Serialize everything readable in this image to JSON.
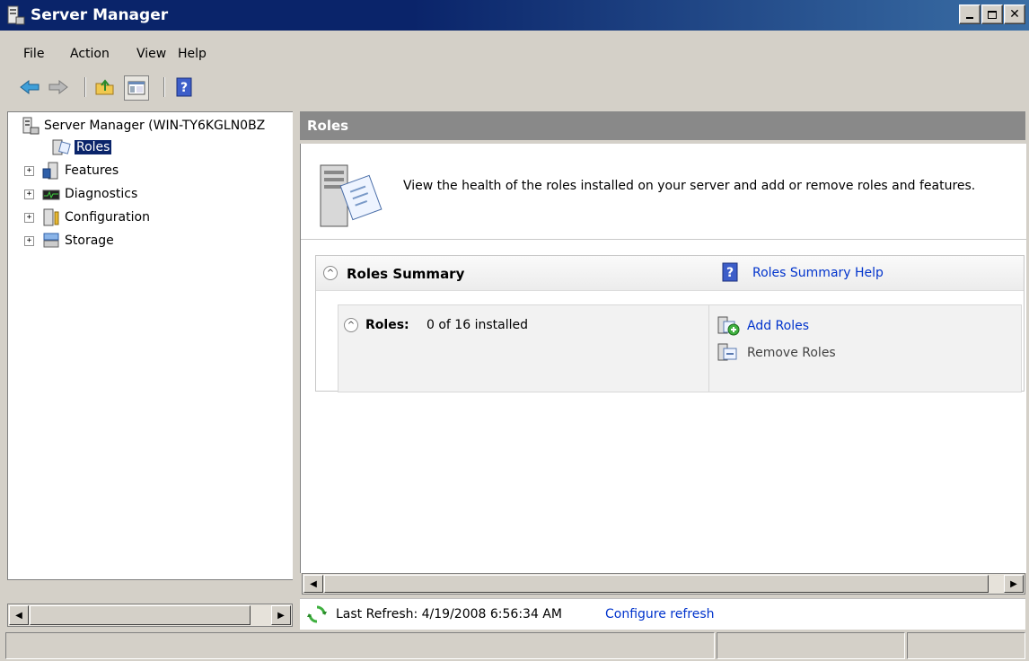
{
  "window": {
    "title": "Server Manager",
    "title_bar_buttons": [
      "minimize",
      "maximize",
      "close"
    ]
  },
  "menu": [
    "File",
    "Action",
    "View",
    "Help"
  ],
  "toolbar": {
    "buttons": [
      "back-arrow-icon",
      "forward-arrow-icon",
      "up-folder-icon",
      "show-hide-tree-icon",
      "help-icon"
    ]
  },
  "tree": {
    "root": "Server Manager (WIN-TY6KGLN0BZ",
    "items": [
      {
        "label": "Roles",
        "selected": true,
        "expandable": false
      },
      {
        "label": "Features",
        "expandable": true
      },
      {
        "label": "Diagnostics",
        "expandable": true
      },
      {
        "label": "Configuration",
        "expandable": true
      },
      {
        "label": "Storage",
        "expandable": true
      }
    ]
  },
  "main": {
    "header": "Roles",
    "intro": "View the health of the roles installed on your server and add or remove roles and features.",
    "summary": {
      "title": "Roles Summary",
      "help_link": "Roles Summary Help",
      "roles_label": "Roles:",
      "roles_count": "0 of 16 installed",
      "actions": [
        "Add Roles",
        "Remove Roles"
      ]
    },
    "refresh": {
      "text": "Last Refresh: 4/19/2008 6:56:34 AM",
      "link": "Configure refresh"
    }
  },
  "colors": {
    "title_bar": "#0a246a",
    "selection": "#0a246a",
    "section_header": "#898989",
    "link": "#0033cc"
  }
}
